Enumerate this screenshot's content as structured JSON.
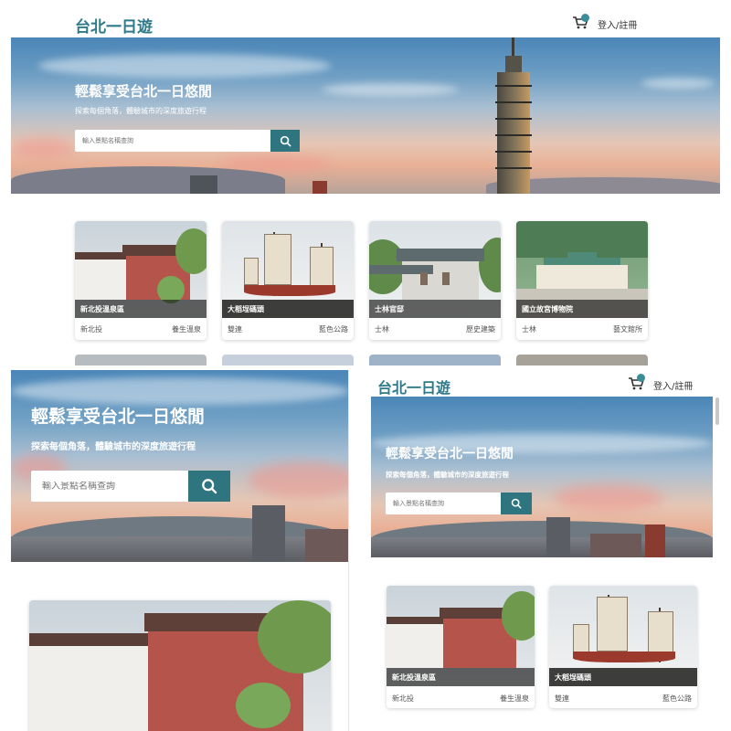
{
  "site": {
    "logo": "台北一日遊",
    "login": "登入/註冊"
  },
  "hero": {
    "title": "輕鬆享受台北一日悠閒",
    "subtitle": "探索每個角落，體驗城市的深度旅遊行程",
    "search_placeholder": "輸入景點名稱查詢"
  },
  "cards": [
    {
      "name": "新北投溫泉區",
      "area": "新北投",
      "category": "養生溫泉"
    },
    {
      "name": "大稻埕碼頭",
      "area": "雙連",
      "category": "藍色公路"
    },
    {
      "name": "士林官邸",
      "area": "士林",
      "category": "歷史建築"
    },
    {
      "name": "國立故宮博物院",
      "area": "士林",
      "category": "藝文館所"
    }
  ],
  "icons": {
    "cart": "cart-icon",
    "search": "search-icon"
  },
  "colors": {
    "brand": "#2e7a8a",
    "search_button": "#2f7580"
  }
}
